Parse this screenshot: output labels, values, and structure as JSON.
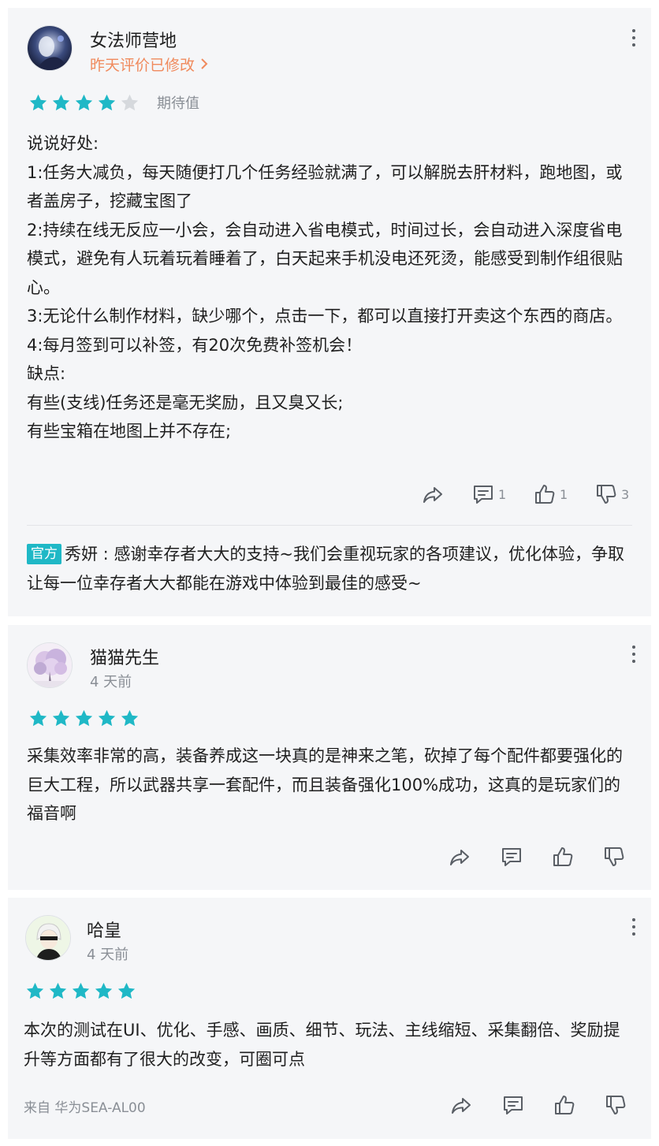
{
  "reviews": [
    {
      "username": "女法师营地",
      "meta": "昨天评价已修改",
      "rating": 4,
      "rating_label": "期待值",
      "lines": [
        "说说好处:",
        "1:任务大减负，每天随便打几个任务经验就满了，可以解脱去肝材料，跑地图，或者盖房子，挖藏宝图了",
        "2:持续在线无反应一小会，会自动进入省电模式，时间过长，会自动进入深度省电模式，避免有人玩着玩着睡着了，白天起来手机没电还死烫，能感受到制作组很贴心。",
        "3:无论什么制作材料，缺少哪个，点击一下，都可以直接打开卖这个东西的商店。",
        "4:每月签到可以补签，有20次免费补签机会！",
        "缺点:",
        "有些(支线)任务还是毫无奖励，且又臭又长;",
        "有些宝箱在地图上并不存在;"
      ],
      "counts": {
        "comments": "1",
        "likes": "1",
        "dislikes": "3"
      },
      "official_reply": {
        "badge": "官方",
        "author": "秀妍",
        "text": "感谢幸存者大大的支持~我们会重视玩家的各项建议，优化体验，争取让每一位幸存者大大都能在游戏中体验到最佳的感受~"
      }
    },
    {
      "username": "猫猫先生",
      "meta": "4 天前",
      "rating": 5,
      "text": "采集效率非常的高，装备养成这一块真的是神来之笔，砍掉了每个配件都要强化的巨大工程，所以武器共享一套配件，而且装备强化100%成功，这真的是玩家们的福音啊"
    },
    {
      "username": "哈皇",
      "meta": "4 天前",
      "rating": 5,
      "text": "本次的测试在UI、优化、手感、画质、细节、玩法、主线缩短、采集翻倍、奖励提升等方面都有了很大的改变，可圈可点",
      "device": "来自 华为SEA-AL00"
    }
  ],
  "colors": {
    "star_filled": "#1fb8c6",
    "star_empty": "#d6d9dd",
    "edited_meta": "#f08a5d",
    "badge": "#1fb8c6"
  },
  "icons": [
    "share-icon",
    "comment-icon",
    "thumbs-up-icon",
    "thumbs-down-icon",
    "more-options-icon",
    "chevron-right-icon",
    "star-icon"
  ]
}
